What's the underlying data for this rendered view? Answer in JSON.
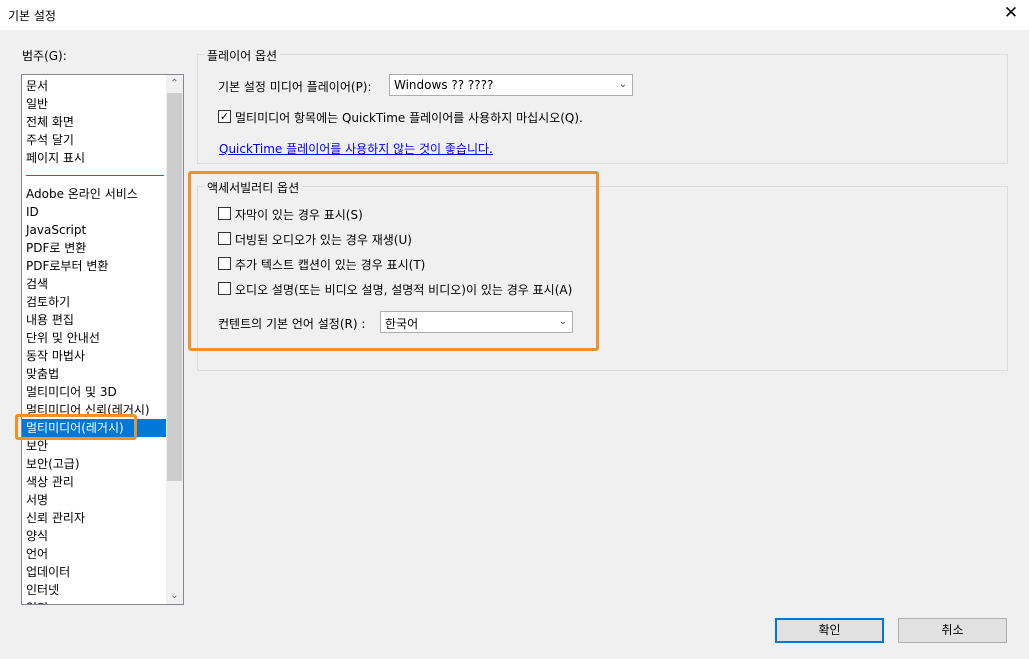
{
  "window": {
    "title": "기본 설정",
    "close_glyph": "✕"
  },
  "category": {
    "label": "범주(G):",
    "scroll_up_glyph": "⌃",
    "scroll_down_glyph": "⌄",
    "group1": [
      "문서",
      "일반",
      "전체 화면",
      "주석 달기",
      "페이지 표시"
    ],
    "group2": [
      "Adobe 온라인 서비스",
      "ID",
      "JavaScript",
      "PDF로 변환",
      "PDF로부터 변환",
      "검색",
      "검토하기",
      "내용 편집",
      "단위 및 안내선",
      "동작 마법사",
      "맞춤법",
      "멀티미디어 및 3D",
      "멀티미디어 신뢰(레거시)",
      "멀티미디어(레거시)",
      "보안",
      "보안(고급)",
      "색상 관리",
      "서명",
      "신뢰 관리자",
      "양식",
      "언어",
      "업데이터",
      "인터넷",
      "읽기"
    ],
    "selected": "멀티미디어(레거시)"
  },
  "player_options": {
    "legend": "플레이어 옵션",
    "default_player_label": "기본 설정 미디어 플레이어(P):",
    "default_player_value": "Windows ?? ????",
    "quicktime_checkbox_label": "멀티미디어 항목에는 QuickTime 플레이어를 사용하지 마십시오(Q).",
    "quicktime_checked": true,
    "check_glyph": "✓",
    "quicktime_link": "QuickTime 플레이어를 사용하지 않는 것이 좋습니다."
  },
  "accessibility_options": {
    "legend": "액세서빌러티 옵션",
    "checkboxes": [
      {
        "label": "자막이 있는 경우 표시(S)",
        "checked": false
      },
      {
        "label": "더빙된 오디오가 있는 경우 재생(U)",
        "checked": false
      },
      {
        "label": "추가 텍스트 캡션이 있는 경우 표시(T)",
        "checked": false
      },
      {
        "label": "오디오 설명(또는 비디오 설명, 설명적 비디오)이 있는 경우 표시(A)",
        "checked": false
      }
    ],
    "language_label": "컨텐트의 기본 언어 설정(R) :",
    "language_value": "한국어"
  },
  "buttons": {
    "ok": "확인",
    "cancel": "취소"
  },
  "colors": {
    "selection": "#0078d7",
    "highlight_box": "#f0912d",
    "link": "#0000ff"
  },
  "icons": {
    "close": "close-icon",
    "combo_arrow": "chevron-down-icon",
    "scroll_up": "chevron-up-icon",
    "scroll_down": "chevron-down-icon"
  }
}
